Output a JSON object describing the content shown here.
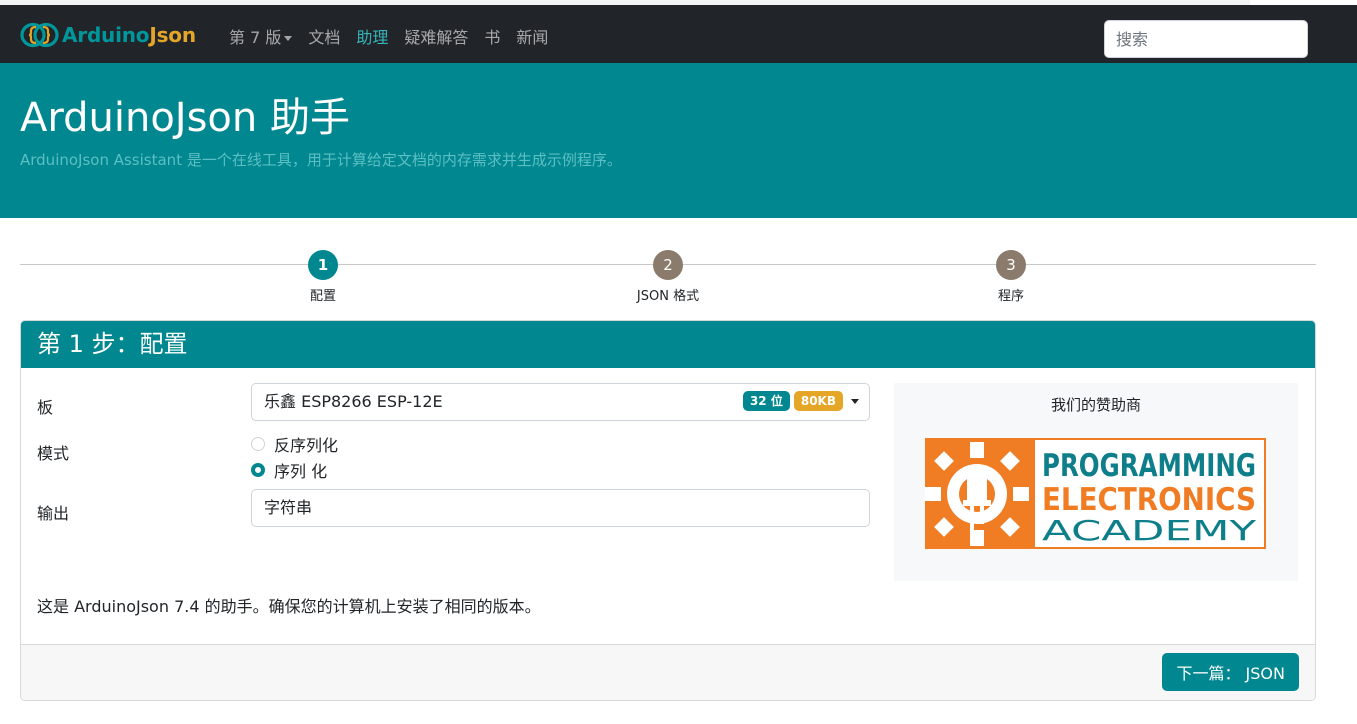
{
  "navbar": {
    "brand_part1": "Arduino",
    "brand_part2": "Json",
    "items": [
      {
        "label": "第 7 版"
      },
      {
        "label": "文档"
      },
      {
        "label": "助理"
      },
      {
        "label": "疑难解答"
      },
      {
        "label": "书"
      },
      {
        "label": "新闻"
      }
    ],
    "active_item": "助理",
    "search_placeholder": "搜索"
  },
  "hero": {
    "title": "ArduinoJson 助手",
    "subtitle": "ArduinoJson Assistant 是一个在线工具，用于计算给定文档的内存需求并生成示例程序。"
  },
  "stepper": {
    "steps": [
      {
        "number": "1",
        "label": "配置",
        "active": true
      },
      {
        "number": "2",
        "label": "JSON 格式",
        "active": false
      },
      {
        "number": "3",
        "label": "程序",
        "active": false
      }
    ]
  },
  "card": {
    "header": "第 1 步：配置",
    "board": {
      "label": "板",
      "value": "乐鑫 ESP8266 ESP-12E",
      "badge_bits": "32 位",
      "badge_ram": "80KB"
    },
    "mode": {
      "label": "模式",
      "options": [
        {
          "label": "反序列化",
          "selected": false
        },
        {
          "label": "序列 化",
          "selected": true
        }
      ]
    },
    "output": {
      "label": "输出",
      "value": "字符串"
    },
    "note": "这是 ArduinoJson 7.4 的助手。确保您的计算机上安装了相同的版本。",
    "next_button": "下一篇： JSON"
  },
  "sponsor": {
    "title": "我们的赞助商",
    "logo_line1": "PROGRAMMING",
    "logo_line2": "ELECTRONICS",
    "logo_line3": "ACADEMY"
  },
  "colors": {
    "navbar_bg": "#212529",
    "accent_teal": "#00878f",
    "brand_gold": "#e5a526",
    "logo_orange": "#f07c23",
    "logo_teal": "#0e7f8a",
    "step_inactive": "#8a7b6c"
  }
}
